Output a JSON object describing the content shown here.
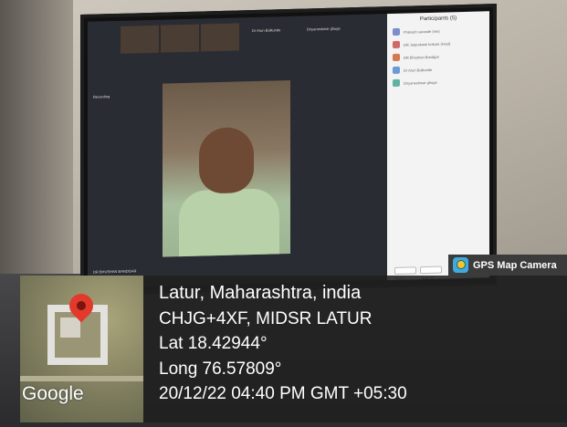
{
  "badge": {
    "label": "GPS Map Camera",
    "icon": "gps-map-camera-app-icon"
  },
  "location": {
    "place": "Latur, Maharashtra, india",
    "plus_code": "CHJG+4XF, MIDSR LATUR",
    "lat": "Lat 18.42944°",
    "long": "Long 76.57809°",
    "datetime": "20/12/22 04:40 PM GMT +05:30"
  },
  "map": {
    "provider": "Google",
    "pin_icon": "location-pin-icon"
  },
  "meeting": {
    "participants_title": "Participants (5)",
    "participants": [
      "Prakash saraede (me)",
      "DR Jaiprakash kokare (Host)",
      "DR Bhushan Bandgar",
      "Dr Arun Balkunde",
      "Dnyaneshwar ghuge"
    ],
    "speaker_label": "DR BHUSHAN BANDGAR",
    "recording_label": "Recording",
    "tile_names": [
      "Dr Arun Balkunde",
      "Dnyaneshwar ghuge"
    ],
    "footer_buttons": [
      "Invite",
      "Mute All"
    ]
  },
  "colors": {
    "overlay_bg": "#202020",
    "badge_bg": "#3b3b3b",
    "pin": "#e3392c",
    "text": "#ffffff"
  }
}
